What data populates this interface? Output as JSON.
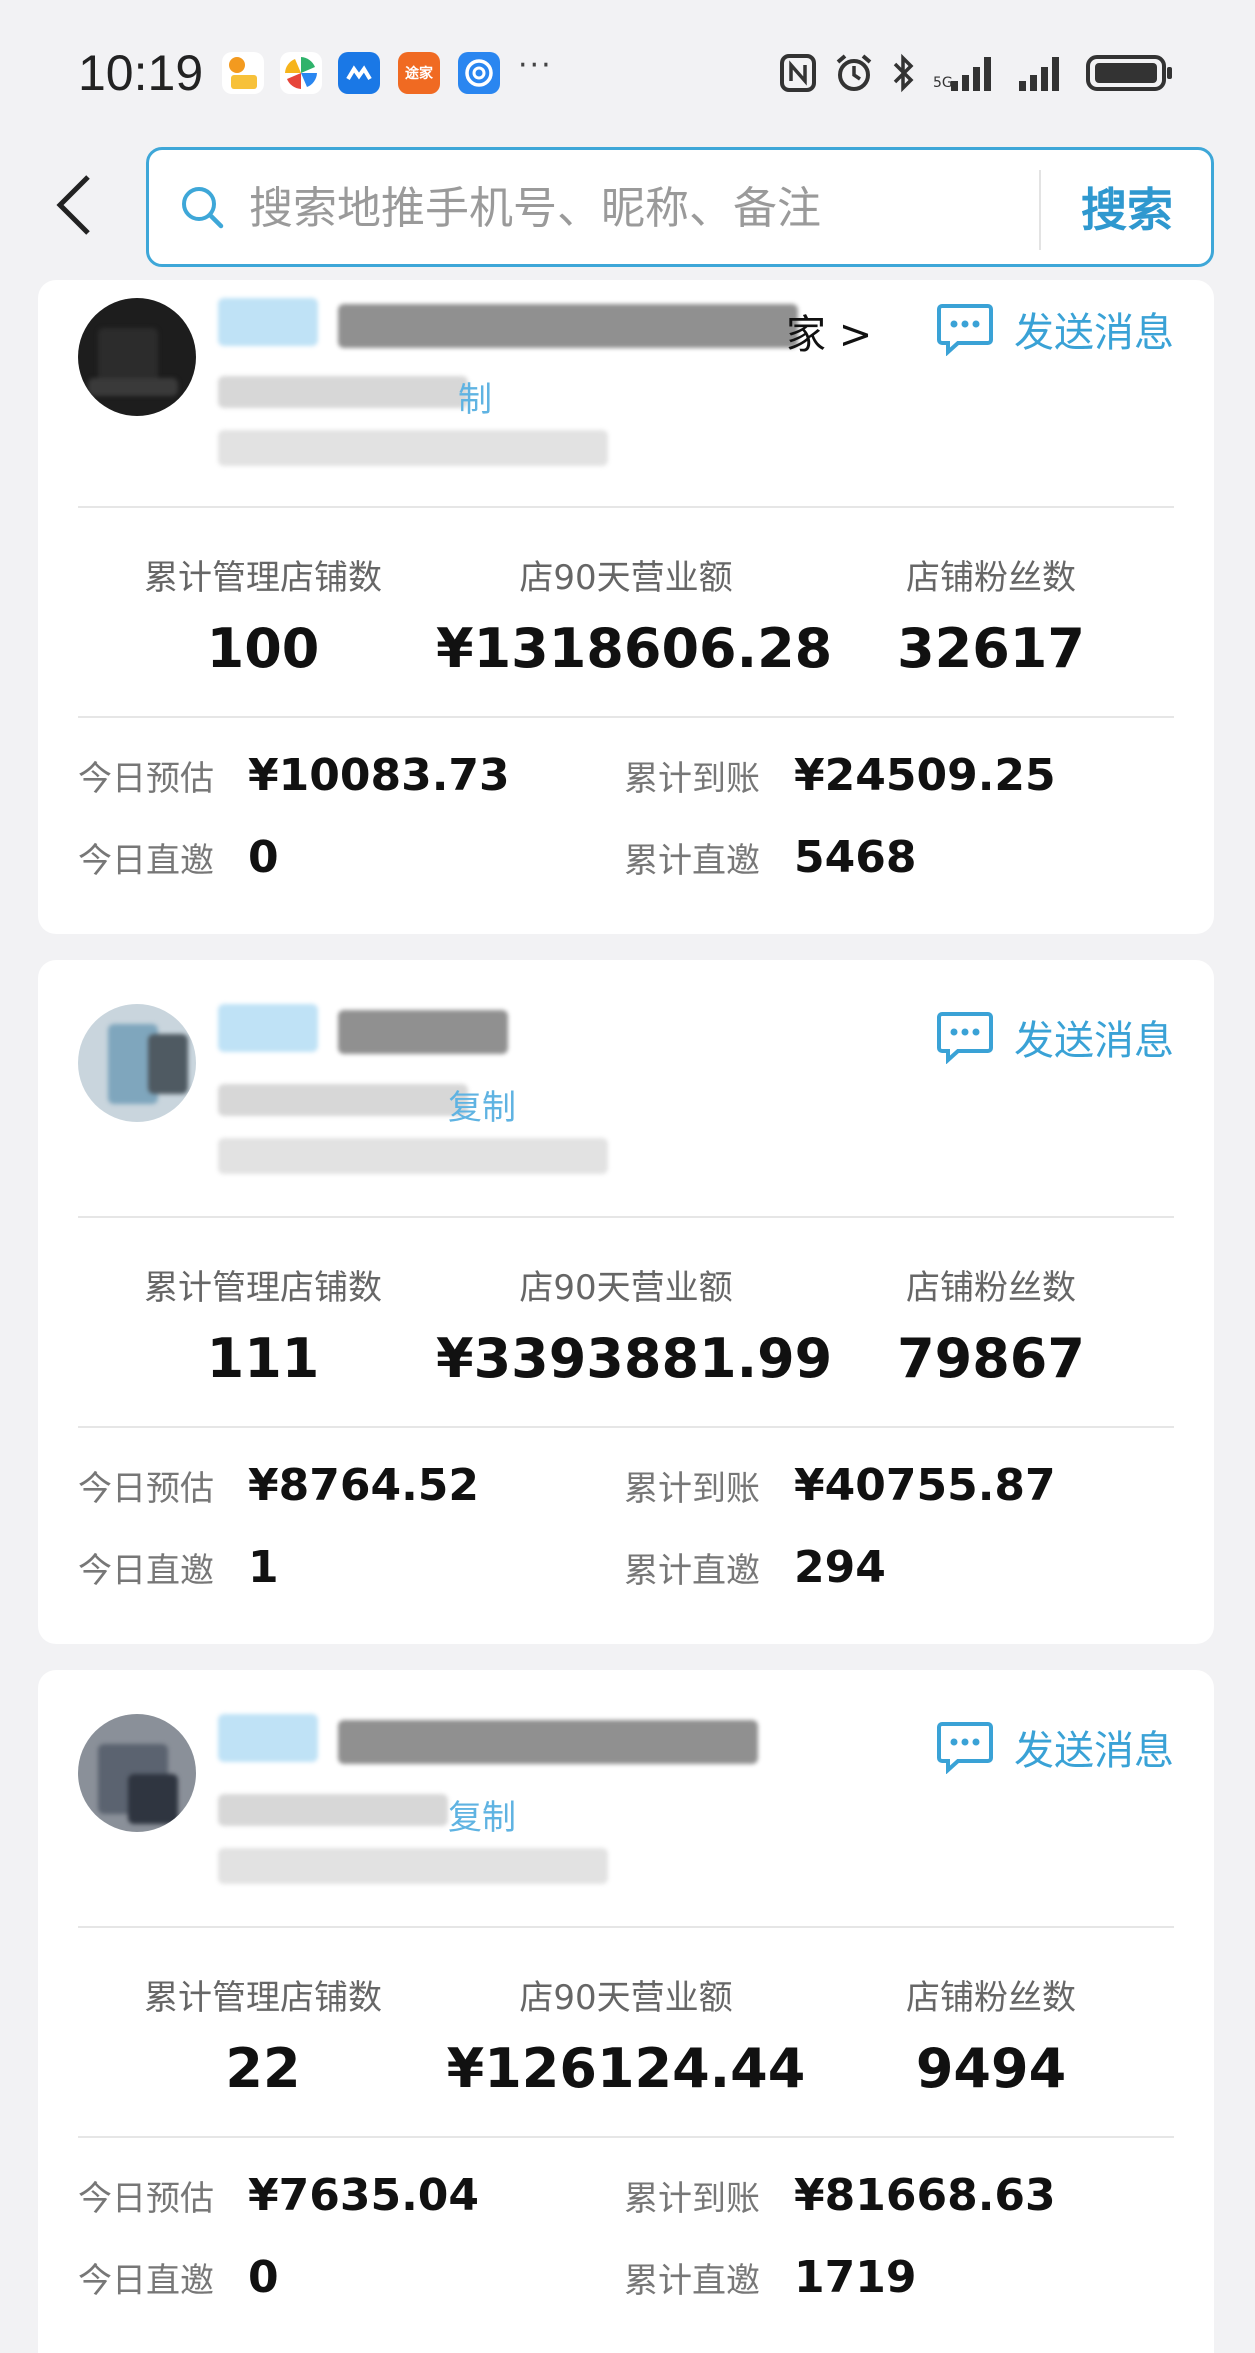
{
  "status_bar": {
    "time": "10:19",
    "app_icons": [
      {
        "name": "lottery-app-icon",
        "color": "#f39a1f"
      },
      {
        "name": "pinwheel-app-icon",
        "color": "#ffffff"
      },
      {
        "name": "cloud-app-icon",
        "color": "#1a78e6"
      },
      {
        "name": "home-app-icon",
        "color": "#f06a22",
        "text": "途家"
      },
      {
        "name": "browser-app-icon",
        "color": "#2a86f0"
      }
    ],
    "more_glyph": "···"
  },
  "search": {
    "placeholder": "搜索地推手机号、昵称、备注",
    "value": "",
    "button_label": "搜索"
  },
  "colors": {
    "accent": "#3aa2d6",
    "background": "#f2f2f4",
    "card": "#ffffff"
  },
  "labels": {
    "send_message": "发送消息",
    "stores": "累计管理店铺数",
    "revenue_90d": "店90天营业额",
    "fans": "店铺粉丝数",
    "today_estimate": "今日预估",
    "total_received": "累计到账",
    "today_direct": "今日直邀",
    "total_direct": "累计直邀"
  },
  "cards": [
    {
      "name_suffix": "家 >",
      "copy_label": "制",
      "stores": "100",
      "revenue_90d": "¥1318606.28",
      "fans": "32617",
      "today_estimate": "¥10083.73",
      "total_received": "¥24509.25",
      "today_direct": "0",
      "total_direct": "5468"
    },
    {
      "name_suffix": "",
      "copy_label": "复制",
      "stores": "111",
      "revenue_90d": "¥3393881.99",
      "fans": "79867",
      "today_estimate": "¥8764.52",
      "total_received": "¥40755.87",
      "today_direct": "1",
      "total_direct": "294"
    },
    {
      "name_suffix": "",
      "copy_label": "复制",
      "stores": "22",
      "revenue_90d": "¥126124.44",
      "fans": "9494",
      "today_estimate": "¥7635.04",
      "total_received": "¥81668.63",
      "today_direct": "0",
      "total_direct": "1719"
    }
  ]
}
